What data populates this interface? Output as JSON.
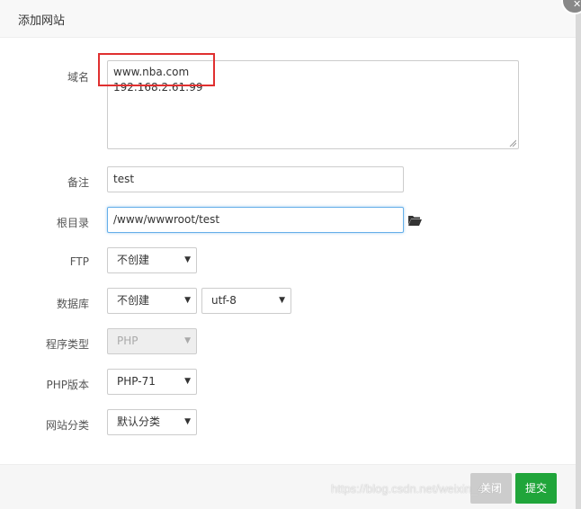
{
  "dialog": {
    "title": "添加网站",
    "close_icon": "close-icon"
  },
  "form": {
    "domain": {
      "label": "域名",
      "lines": [
        "www.nba.com",
        "192.168.2.61:99"
      ]
    },
    "remark": {
      "label": "备注",
      "value": "test"
    },
    "root": {
      "label": "根目录",
      "value": "/www/wwwroot/test",
      "browse_icon": "folder-open-icon"
    },
    "ftp": {
      "label": "FTP",
      "selected": "不创建"
    },
    "database": {
      "label": "数据库",
      "selected": "不创建",
      "charset": "utf-8"
    },
    "program_type": {
      "label": "程序类型",
      "selected": "PHP"
    },
    "php_version": {
      "label": "PHP版本",
      "selected": "PHP-71"
    },
    "site_category": {
      "label": "网站分类",
      "selected": "默认分类"
    }
  },
  "footer": {
    "close_label": "关闭",
    "submit_label": "提交"
  },
  "watermark": "https://blog.csdn.net/weixin_4...",
  "colors": {
    "submit": "#20a53a",
    "highlight": "#e03030",
    "focus": "#66afe9"
  }
}
